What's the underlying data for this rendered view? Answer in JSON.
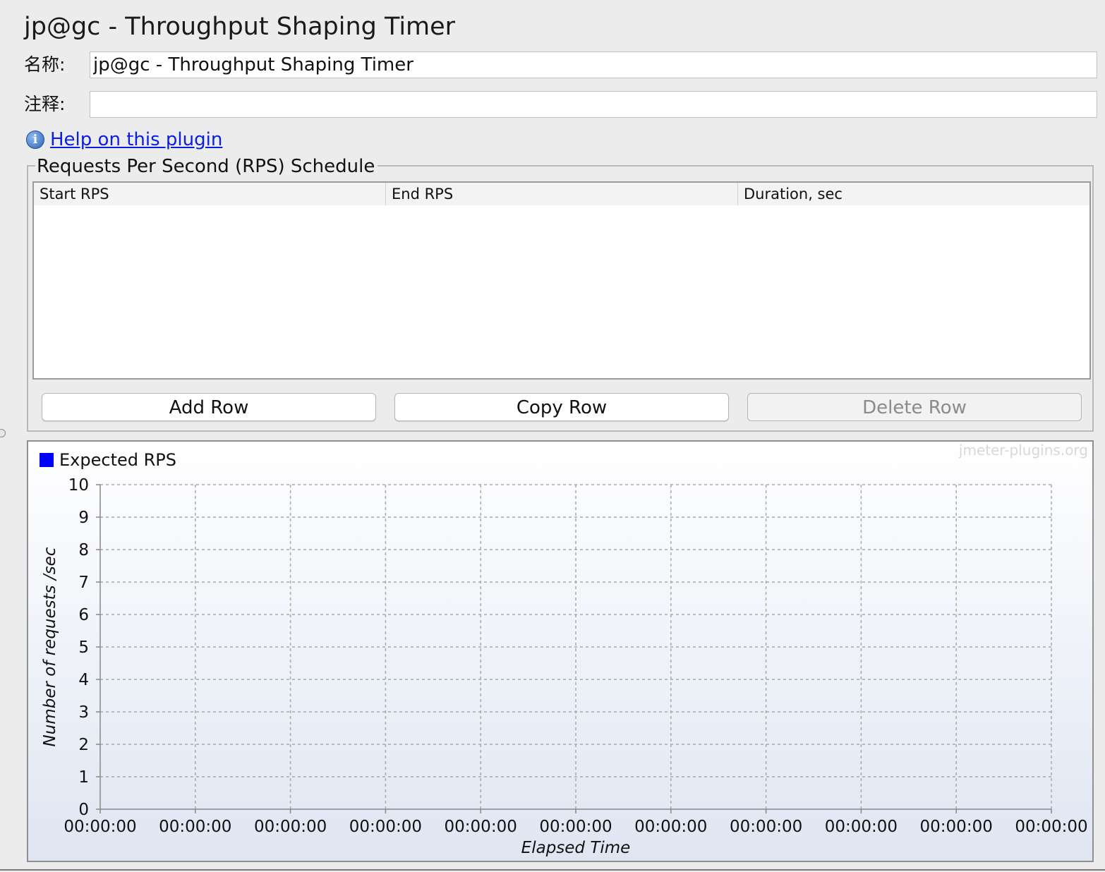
{
  "window": {
    "title": "jp@gc - Throughput Shaping Timer"
  },
  "form": {
    "name_label": "名称:",
    "name_value": "jp@gc - Throughput Shaping Timer",
    "comment_label": "注释:",
    "comment_value": ""
  },
  "help": {
    "link_text": "Help on this plugin",
    "icon": "info-icon"
  },
  "schedule": {
    "group_title": "Requests Per Second (RPS) Schedule",
    "columns": [
      "Start RPS",
      "End RPS",
      "Duration, sec"
    ],
    "rows": [],
    "buttons": {
      "add": "Add Row",
      "copy": "Copy Row",
      "delete": "Delete Row"
    }
  },
  "chart": {
    "watermark": "jmeter-plugins.org",
    "legend": "Expected RPS",
    "legend_color": "#0000ff"
  },
  "chart_data": {
    "type": "line",
    "title": "",
    "xlabel": "Elapsed Time",
    "ylabel": "Number of requests /sec",
    "ylim": [
      0,
      10
    ],
    "y_ticks": [
      "0",
      "1",
      "2",
      "3",
      "4",
      "5",
      "6",
      "7",
      "8",
      "9",
      "10"
    ],
    "x_ticks": [
      "00:00:00",
      "00:00:00",
      "00:00:00",
      "00:00:00",
      "00:00:00",
      "00:00:00",
      "00:00:00",
      "00:00:00",
      "00:00:00",
      "00:00:00",
      "00:00:00"
    ],
    "series": [
      {
        "name": "Expected RPS",
        "color": "#0000ff",
        "values": []
      }
    ],
    "grid": true,
    "legend_position": "top-left"
  }
}
